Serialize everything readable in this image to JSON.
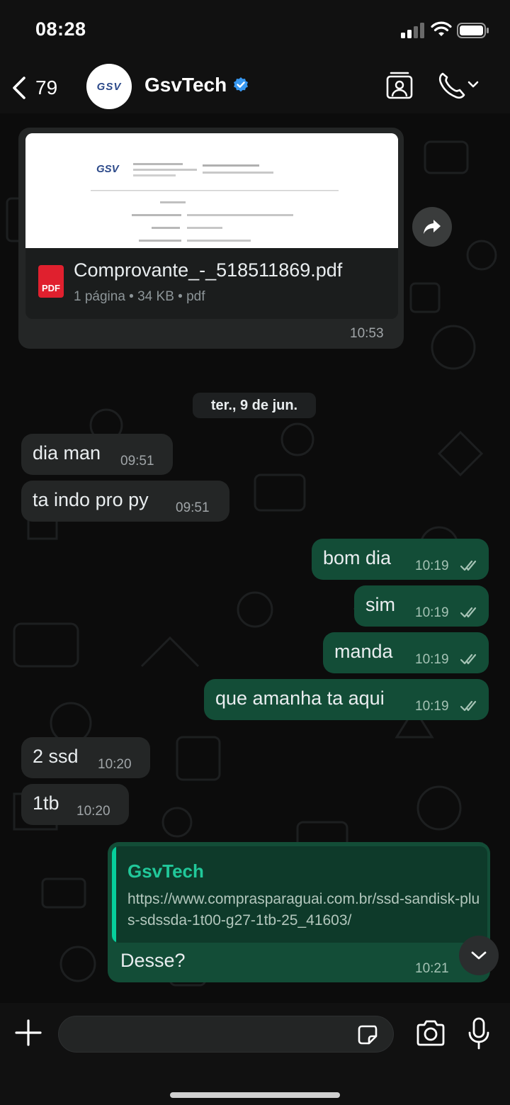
{
  "status_bar": {
    "time": "08:28",
    "icons": [
      "signal-icon",
      "wifi-icon",
      "battery-icon"
    ]
  },
  "header": {
    "back_count": "79",
    "avatar_logo": "GSV",
    "contact_name": "GsvTech",
    "verified": true,
    "icons": [
      "chevron-left-icon",
      "verified-badge-icon",
      "contact-card-icon",
      "phone-icon",
      "chevron-down-icon"
    ]
  },
  "document_message": {
    "file_name": "Comprovante_-_518511869.pdf",
    "file_icon_label": "PDF",
    "meta": "1 página • 34 KB • pdf",
    "time": "10:53",
    "preview_lines": [
      "GSV TECH",
      "Comprovante de Pix",
      "Dados",
      "Identificador",
      "Valor",
      "Data/Hora"
    ]
  },
  "date_separator": "ter., 9 de jun.",
  "messages": [
    {
      "direction": "in",
      "text": "dia man",
      "time": "09:51"
    },
    {
      "direction": "in",
      "text": "ta indo pro py",
      "time": "09:51"
    },
    {
      "direction": "out",
      "text": "bom dia",
      "time": "10:19",
      "read": true
    },
    {
      "direction": "out",
      "text": "sim",
      "time": "10:19",
      "read": true
    },
    {
      "direction": "out",
      "text": "manda",
      "time": "10:19",
      "read": true
    },
    {
      "direction": "out",
      "text": "que amanha ta aqui",
      "time": "10:19",
      "read": true
    },
    {
      "direction": "in",
      "text": "2 ssd",
      "time": "10:20"
    },
    {
      "direction": "in",
      "text": "1tb",
      "time": "10:20"
    }
  ],
  "reply_message": {
    "quoted_author": "GsvTech",
    "quoted_text": "https://www.comprasparaguai.com.br/ssd-sandisk-plus-sdssda-1t00-g27-1tb-25_41603/",
    "text": "Desse?",
    "time": "10:21"
  },
  "composer": {
    "input_value": "",
    "input_placeholder": "",
    "icons": [
      "plus-icon",
      "sticker-icon",
      "camera-icon",
      "microphone-icon"
    ]
  },
  "colors": {
    "background": "#0b0b0b",
    "incoming_bubble": "#242626",
    "outgoing_bubble": "#134d37",
    "accent": "#21c89a",
    "verified": "#3797f0",
    "pdf_red": "#e0202e"
  }
}
